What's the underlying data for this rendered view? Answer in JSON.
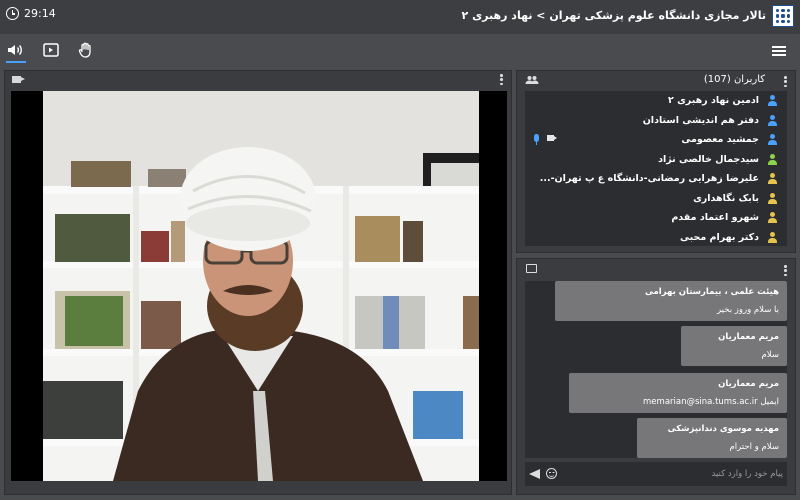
{
  "header": {
    "timer": "29:14",
    "room_title": "تالار مجازی دانشگاه علوم پزشکی تهران > نهاد رهبری ۲"
  },
  "toolbar": {
    "icons": [
      "volume-icon",
      "screen-share-icon",
      "raise-hand-icon",
      "menu-icon"
    ],
    "active_accent": "#4aa0ff"
  },
  "participants": {
    "title": "کاربران (107)",
    "items": [
      {
        "name": "ادمین نهاد رهبری ۲",
        "role_color": "#4aa0ff"
      },
      {
        "name": "دفتر هم اندیشی استادان",
        "role_color": "#4aa0ff"
      },
      {
        "name": "جمشید معصومی",
        "role_color": "#4aa0ff"
      },
      {
        "name": "سیدجمال خالصی نژاد",
        "role_color": "#8bd449"
      },
      {
        "name": "علیرضا زهرایی رمضانی-دانشگاه ع پ تهران-...",
        "role_color": "#e6c34a"
      },
      {
        "name": "بابک نگاهداری",
        "role_color": "#e6c34a"
      },
      {
        "name": "شهرو اعتماد مقدم",
        "role_color": "#e6c34a"
      },
      {
        "name": "دکتر بهرام محبی",
        "role_color": "#e6c34a"
      }
    ]
  },
  "chat": {
    "messages": [
      {
        "sender": "هیئت علمی ، بیمارستان بهرامی",
        "text": "با سلام وروز بخیر"
      },
      {
        "sender": "مریم معماریان",
        "text": "سلام"
      },
      {
        "sender": "مریم معماریان",
        "text": "memarian@sina.tums.ac.ir ایمیل"
      },
      {
        "sender": "مهدیه موسوی دندانپزشکی",
        "text": "سلام و احترام"
      }
    ],
    "input_placeholder": "پیام خود را وارد کنید"
  },
  "colors": {
    "background": "#4a4b4e",
    "panel": "#3b3c3f",
    "panel_inner": "#2c2d30",
    "message_bubble": "#777779"
  }
}
